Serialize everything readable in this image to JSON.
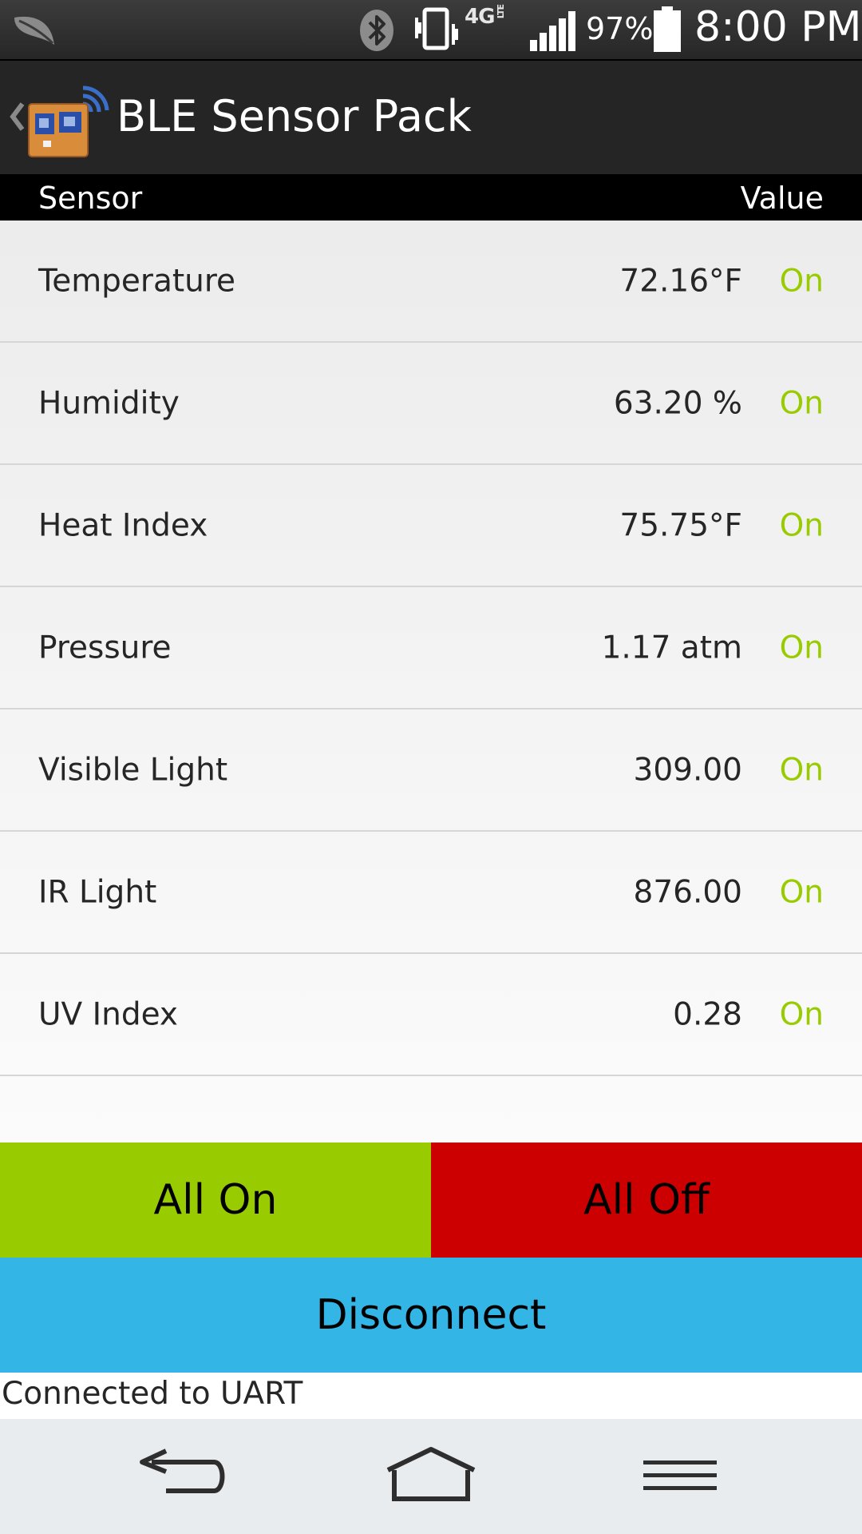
{
  "status_bar": {
    "battery_percent": "97%",
    "network": "4G",
    "network_sub": "LTE",
    "time": "8:00 PM",
    "icons": [
      "leaf-notification-icon",
      "bluetooth-icon",
      "vibrate-icon",
      "lte-icon",
      "signal-icon",
      "battery-icon"
    ]
  },
  "action_bar": {
    "title": "BLE Sensor Pack",
    "icons": [
      "up-chevron-icon",
      "app-board-icon"
    ]
  },
  "table": {
    "header_sensor": "Sensor",
    "header_value": "Value",
    "rows": [
      {
        "name": "Temperature",
        "value": "72.16°F",
        "state": "On"
      },
      {
        "name": "Humidity",
        "value": "63.20 %",
        "state": "On"
      },
      {
        "name": "Heat Index",
        "value": "75.75°F",
        "state": "On"
      },
      {
        "name": "Pressure",
        "value": "1.17 atm",
        "state": "On"
      },
      {
        "name": "Visible Light",
        "value": "309.00",
        "state": "On"
      },
      {
        "name": "IR Light",
        "value": "876.00",
        "state": "On"
      },
      {
        "name": "UV Index",
        "value": "0.28",
        "state": "On"
      }
    ]
  },
  "buttons": {
    "all_on": "All On",
    "all_off": "All Off",
    "disconnect": "Disconnect"
  },
  "connection_status": "Connected to UART",
  "nav_bar": {
    "icons": [
      "back-icon",
      "home-icon",
      "menu-icon"
    ]
  },
  "colors": {
    "on_green": "#99cc00",
    "off_red": "#cc0000",
    "disconnect_blue": "#33b5e5",
    "action_bar": "#252525"
  }
}
